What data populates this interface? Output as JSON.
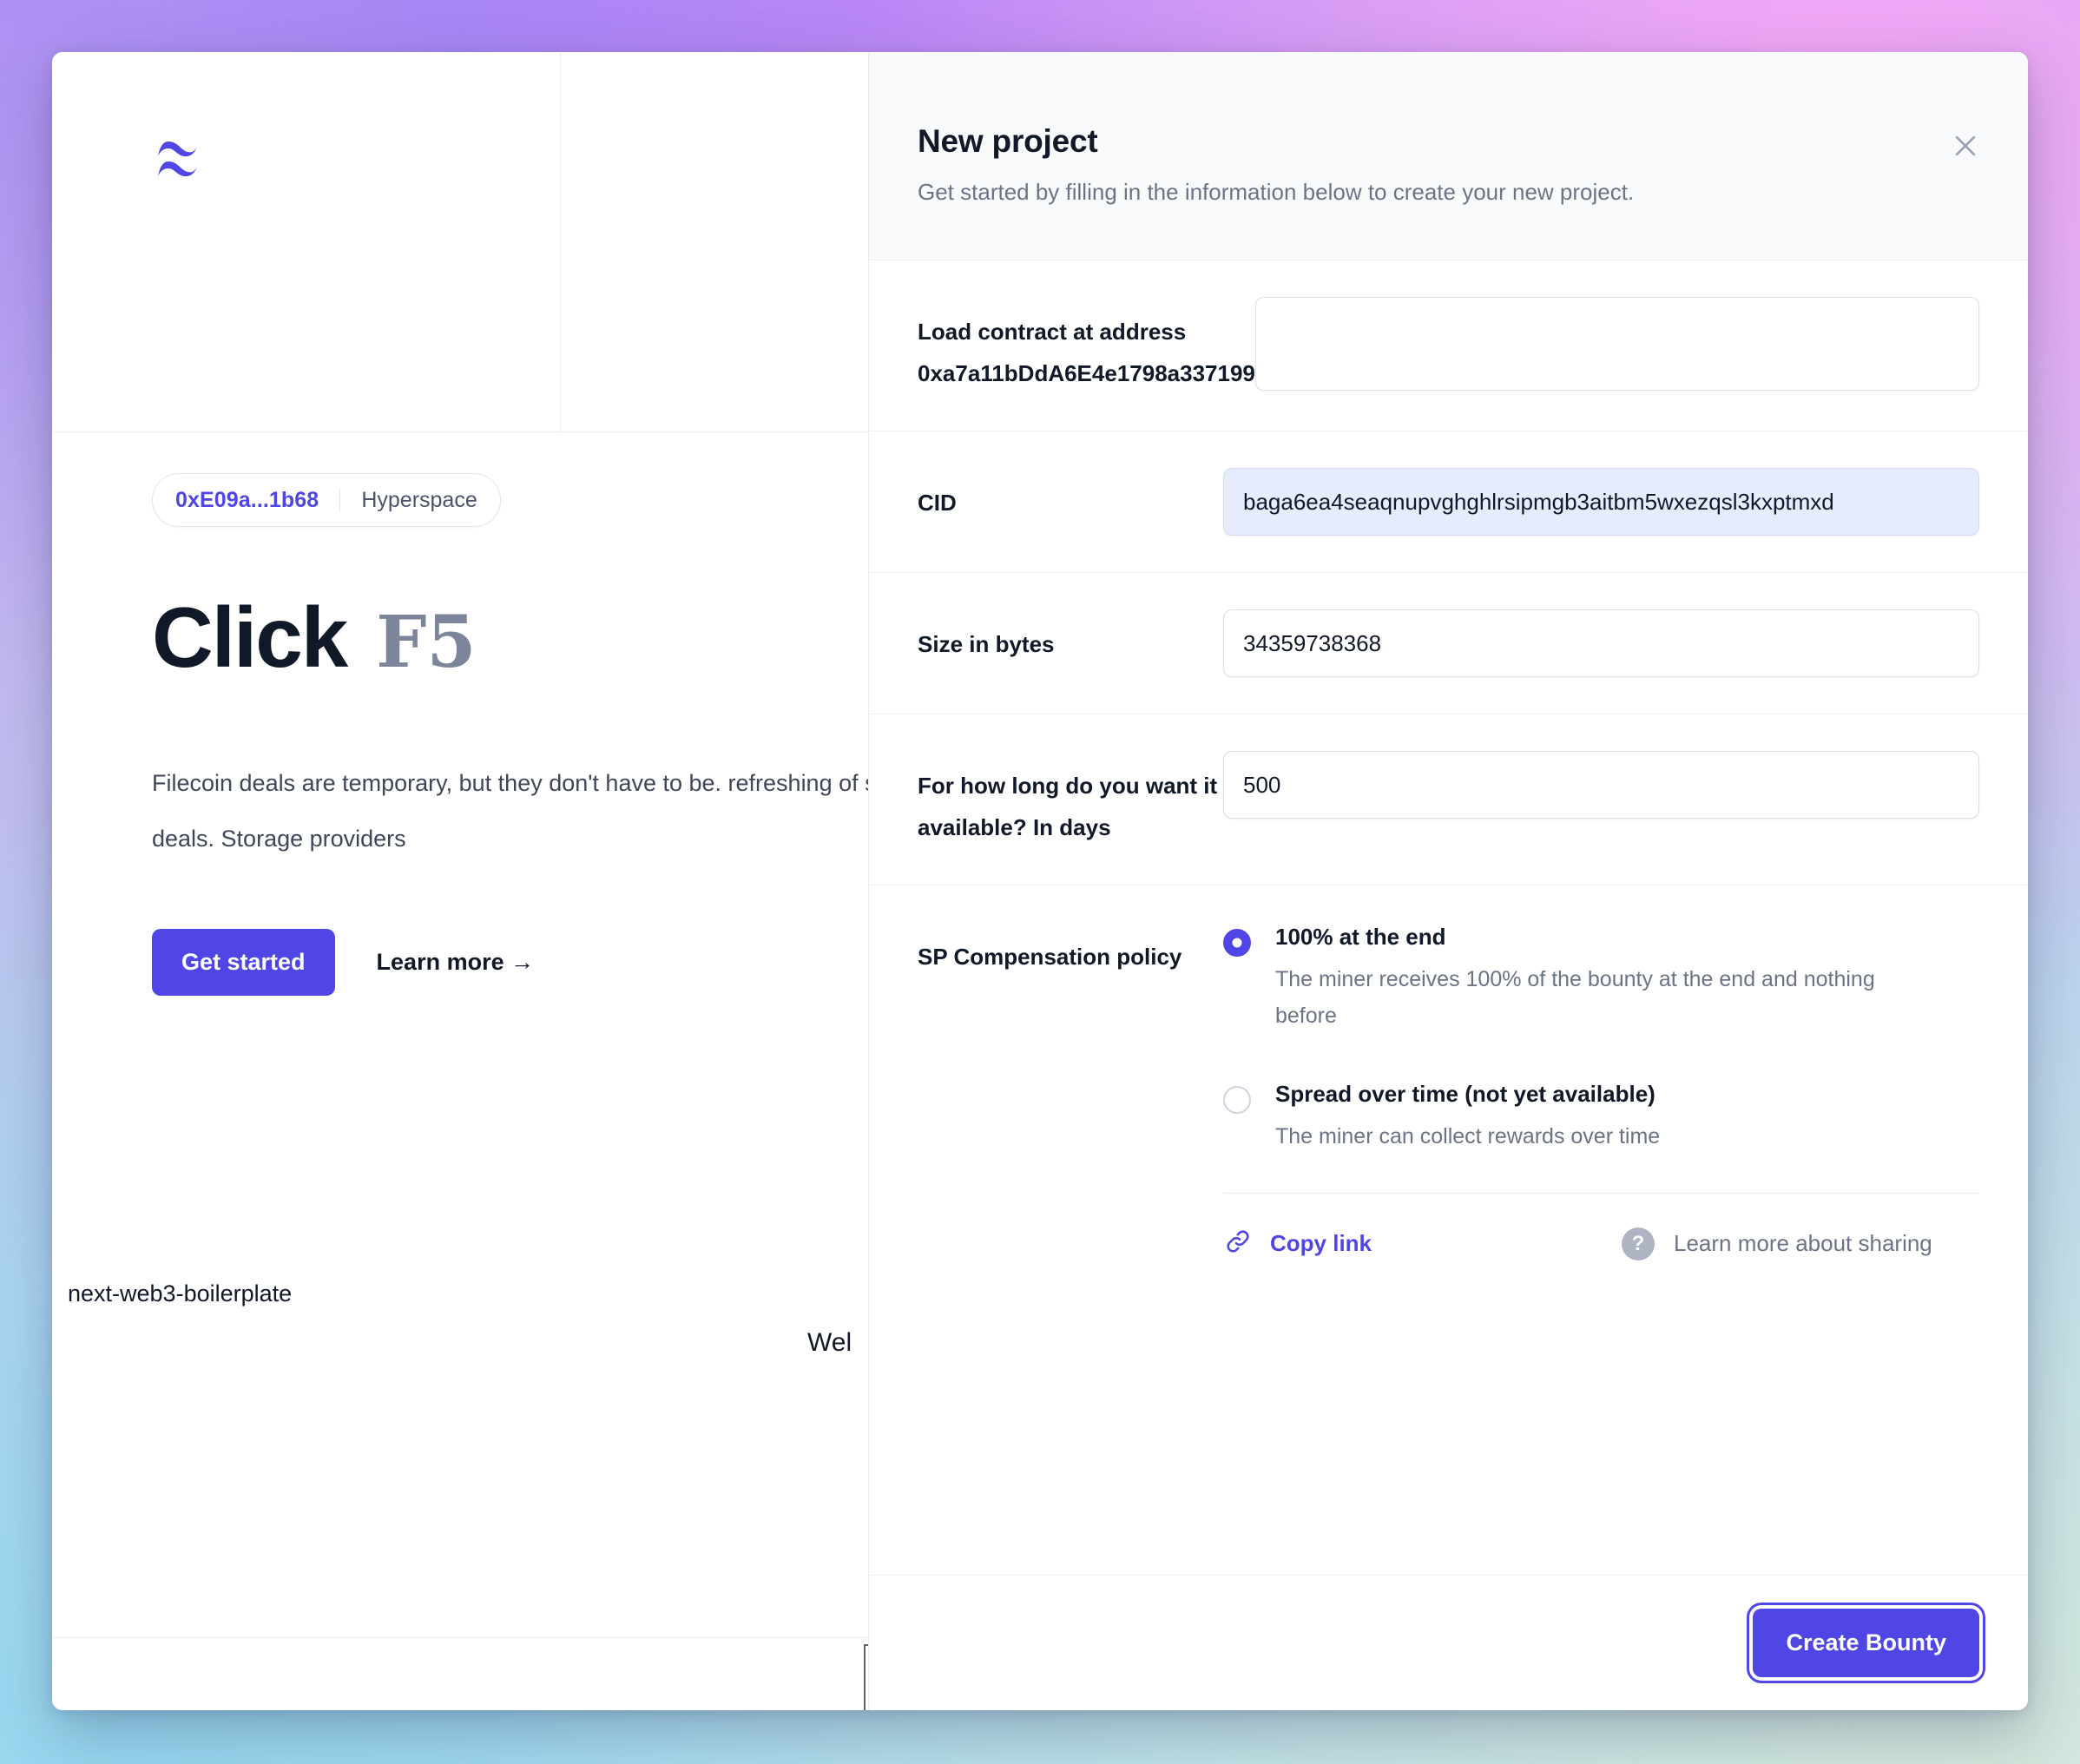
{
  "background_page": {
    "logo_icon": "wave-logo-icon",
    "chain_badge": {
      "address": "0xE09a...1b68",
      "network": "Hyperspace"
    },
    "hero": {
      "title_main": "Click",
      "title_accent": "F5",
      "body": "Filecoin deals are temporary, but they don't have to be. refreshing of storage deals. Storage providers",
      "primary_button": "Get started",
      "secondary_link": "Learn more →"
    },
    "repo_label": "next-web3-boilerplate",
    "welcome_clipped": "Wel"
  },
  "modal": {
    "title": "New project",
    "subtitle": "Get started by filling in the information below to create your new project.",
    "close_icon": "close-icon",
    "fields": [
      {
        "label": "Load contract at address",
        "label_line2": "0xa7a11bDdA6E4e1798a337199",
        "value": "",
        "placeholder": ""
      },
      {
        "label": "CID",
        "value": "baga6ea4seaqnupvghghlrsipmgb3aitbm5wxezqsl3kxptmxd",
        "placeholder": ""
      },
      {
        "label": "Size in bytes",
        "value": "34359738368",
        "placeholder": ""
      },
      {
        "label": "For how long do you want it available? In days",
        "value": "500",
        "placeholder": ""
      }
    ],
    "compensation": {
      "label": "SP Compensation policy",
      "options": [
        {
          "title": "100% at the end",
          "description": "The miner receives 100% of the bounty at the end and nothing before",
          "selected": true
        },
        {
          "title": "Spread over time (not yet available)",
          "description": "The miner can collect rewards over time",
          "selected": false
        }
      ]
    },
    "sharing": {
      "copy_link_label": "Copy link",
      "copy_link_icon": "link-icon",
      "help_icon": "question-mark-icon",
      "help_label": "Learn more about sharing"
    },
    "footer": {
      "submit_label": "Create Bounty"
    }
  },
  "colors": {
    "accent": "#4f46e5",
    "selected_input_bg": "#e6ecfb",
    "muted_text": "#6b7385",
    "header_bg": "#f8fafc"
  }
}
